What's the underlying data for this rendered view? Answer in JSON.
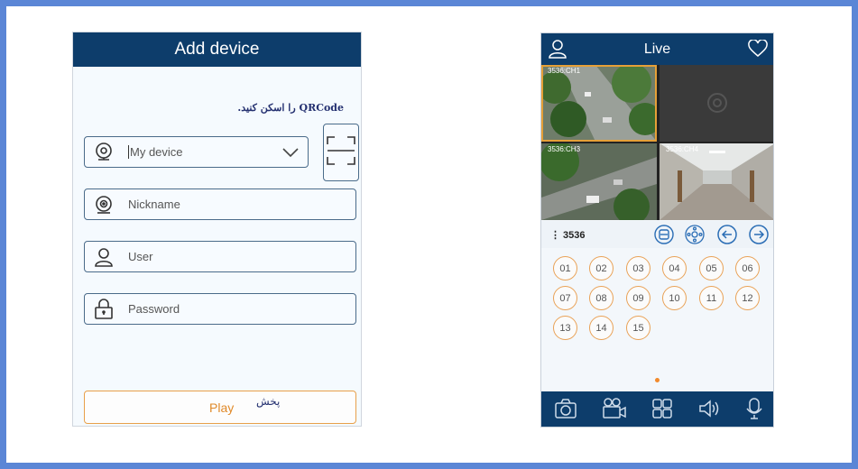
{
  "add_device": {
    "title": "Add device",
    "qr_hint": "QRCode را اسکن کنید.",
    "device_field": {
      "value": "My device"
    },
    "nickname_field": {
      "placeholder": "Nickname"
    },
    "user_field": {
      "placeholder": "User"
    },
    "password_field": {
      "placeholder": "Password"
    },
    "play_button": {
      "label": "Play",
      "label_fa": "پخش"
    }
  },
  "live": {
    "title": "Live",
    "tiles": [
      "3536:CH1",
      "",
      "3536:CH3",
      "3536:CH4"
    ],
    "device_name": "⋮ 3536",
    "channels": [
      "01",
      "02",
      "03",
      "04",
      "05",
      "06",
      "07",
      "08",
      "09",
      "10",
      "11",
      "12",
      "13",
      "14",
      "15"
    ]
  },
  "colors": {
    "header": "#0d3d6b",
    "accent_orange": "#e9a257",
    "frame_border": "#5b86d6"
  },
  "icons": {
    "left": [
      "webcam-icon",
      "camera-device-icon",
      "user-icon",
      "lock-icon",
      "qr-scan-icon",
      "chevron-down-icon"
    ],
    "right_header": [
      "user-icon",
      "heart-icon"
    ],
    "controls": [
      "fit-screen-icon",
      "ptz-icon",
      "arrow-left-icon",
      "arrow-right-icon"
    ],
    "bottom": [
      "camera-snapshot-icon",
      "record-icon",
      "grid-layout-icon",
      "speaker-icon",
      "microphone-icon"
    ]
  }
}
